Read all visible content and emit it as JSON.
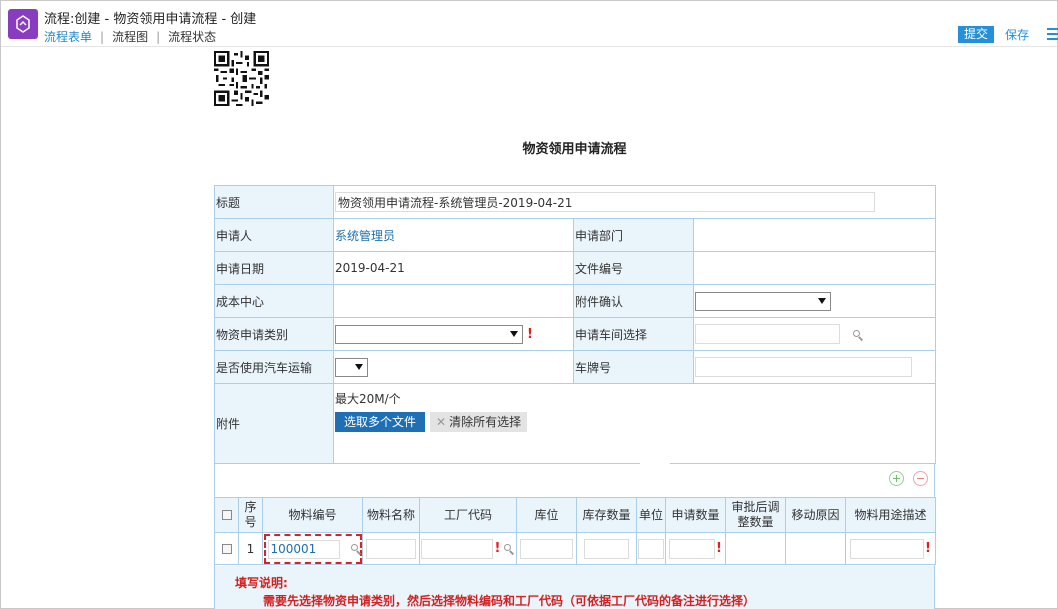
{
  "header": {
    "title": "流程:创建 - 物资领用申请流程 - 创建",
    "tabs": [
      {
        "label": "流程表单",
        "active": true
      },
      {
        "label": "流程图",
        "active": false
      },
      {
        "label": "流程状态",
        "active": false
      }
    ],
    "submit_label": "提交",
    "save_label": "保存",
    "icons": {
      "app": "workflow-icon",
      "more": "list-menu-icon"
    }
  },
  "form_title": "物资领用申请流程",
  "fields": {
    "title_label": "标题",
    "title_value": "物资领用申请流程-系统管理员-2019-04-21",
    "applicant_label": "申请人",
    "applicant_value": "系统管理员",
    "dept_label": "申请部门",
    "dept_value": "",
    "date_label": "申请日期",
    "date_value": "2019-04-21",
    "doc_no_label": "文件编号",
    "doc_no_value": "",
    "cost_center_label": "成本中心",
    "cost_center_value": "",
    "attach_confirm_label": "附件确认",
    "attach_confirm_value": "",
    "material_category_label": "物资申请类别",
    "material_category_value": "",
    "workshop_label": "申请车间选择",
    "workshop_value": "",
    "use_car_label": "是否使用汽车运输",
    "use_car_value": "",
    "plate_label": "车牌号",
    "plate_value": "",
    "attachment_label": "附件",
    "attachment_limit": "最大20M/个",
    "upload_button": "选取多个文件",
    "clear_button": "清除所有选择"
  },
  "detail": {
    "columns": [
      "序号",
      "物料编号",
      "物料名称",
      "工厂代码",
      "库位",
      "库存数量",
      "单位",
      "申请数量",
      "审批后调整数量",
      "移动原因",
      "物料用途描述"
    ],
    "rows": [
      {
        "index": "1",
        "material_code": "100001"
      }
    ]
  },
  "notes": {
    "heading": "填写说明:",
    "text": "需要先选择物资申请类别，然后选择物料编码和工厂代码（可依据工厂代码的备注进行选择）"
  },
  "colors": {
    "accent": "#2590d8",
    "label_bg": "#eaf4fb",
    "border": "#a9cfea",
    "required": "#e02020",
    "app_icon": "#8a3cc0"
  }
}
